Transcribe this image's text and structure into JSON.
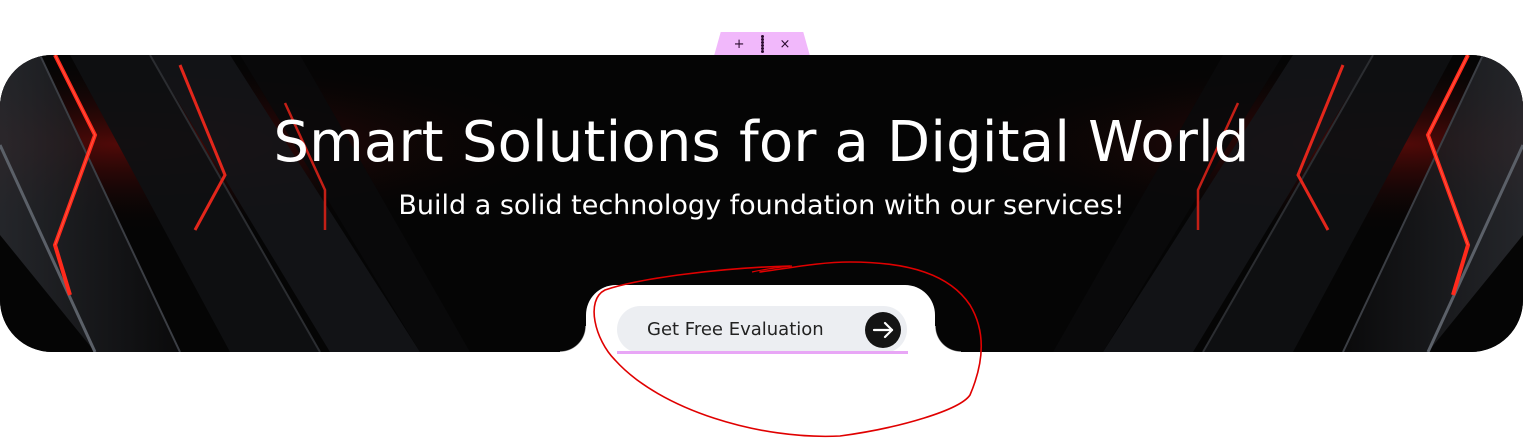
{
  "editor_toolbar": {
    "add_symbol": "+",
    "close_symbol": "×",
    "icons": [
      "plus-icon",
      "drag-grip-icon",
      "close-icon"
    ],
    "color": "#f1b8fb"
  },
  "hero": {
    "title": "Smart Solutions for a Digital World",
    "subtitle": "Build a solid technology foundation with our services!",
    "background_color": "#050505",
    "accent_color": "#e3261b"
  },
  "cta": {
    "label": "Get Free Evaluation",
    "icon": "arrow-right-icon",
    "background": "#eceef2"
  },
  "annotation": {
    "type": "hand-drawn-circle",
    "color": "#e00000"
  }
}
